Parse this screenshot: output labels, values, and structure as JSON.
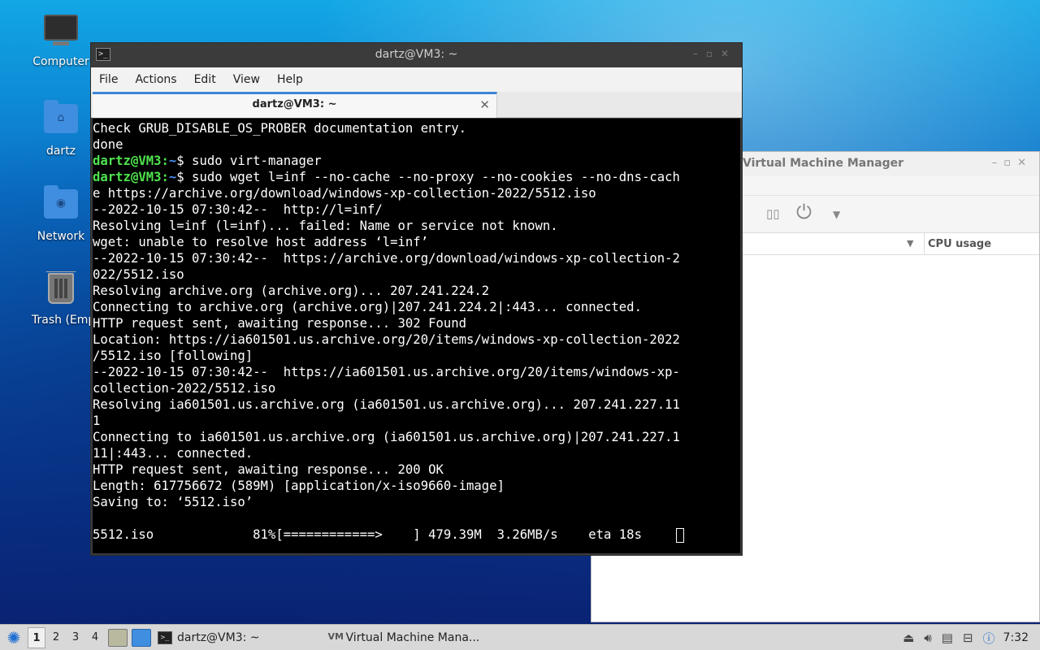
{
  "desktop": {
    "icons": [
      {
        "label": "Computer"
      },
      {
        "label": "dartz"
      },
      {
        "label": "Network"
      },
      {
        "label": "Trash (Empty)"
      }
    ]
  },
  "vmm_window": {
    "title": "Virtual Machine Manager",
    "column_header": "CPU usage"
  },
  "terminal_window": {
    "title": "dartz@VM3: ~",
    "menu": [
      "File",
      "Actions",
      "Edit",
      "View",
      "Help"
    ],
    "tab_title": "dartz@VM3: ~",
    "prompt_user": "dartz@VM3",
    "prompt_path": "~",
    "lines": [
      "Check GRUB_DISABLE_OS_PROBER documentation entry.",
      "done",
      {
        "prompt": true,
        "cmd": "$ sudo virt-manager"
      },
      {
        "prompt": true,
        "cmd": "$ sudo wget l=inf --no-cache --no-proxy --no-cookies --no-dns-cach"
      },
      "e https://archive.org/download/windows-xp-collection-2022/5512.iso",
      "--2022-10-15 07:30:42--  http://l=inf/",
      "Resolving l=inf (l=inf)... failed: Name or service not known.",
      "wget: unable to resolve host address ‘l=inf’",
      "--2022-10-15 07:30:42--  https://archive.org/download/windows-xp-collection-2",
      "022/5512.iso",
      "Resolving archive.org (archive.org)... 207.241.224.2",
      "Connecting to archive.org (archive.org)|207.241.224.2|:443... connected.",
      "HTTP request sent, awaiting response... 302 Found",
      "Location: https://ia601501.us.archive.org/20/items/windows-xp-collection-2022",
      "/5512.iso [following]",
      "--2022-10-15 07:30:42--  https://ia601501.us.archive.org/20/items/windows-xp-",
      "collection-2022/5512.iso",
      "Resolving ia601501.us.archive.org (ia601501.us.archive.org)... 207.241.227.11",
      "1",
      "Connecting to ia601501.us.archive.org (ia601501.us.archive.org)|207.241.227.1",
      "11|:443... connected.",
      "HTTP request sent, awaiting response... 200 OK",
      "Length: 617756672 (589M) [application/x-iso9660-image]",
      "Saving to: ‘5512.iso’",
      "",
      "5512.iso             81%[============>    ] 479.39M  3.26MB/s    eta 18s    "
    ]
  },
  "taskbar": {
    "workspaces": [
      "1",
      "2",
      "3",
      "4"
    ],
    "active_workspace": "1",
    "tasks": [
      {
        "label": "dartz@VM3: ~"
      },
      {
        "label": "Virtual Machine Mana..."
      }
    ],
    "clock": "7:32"
  }
}
